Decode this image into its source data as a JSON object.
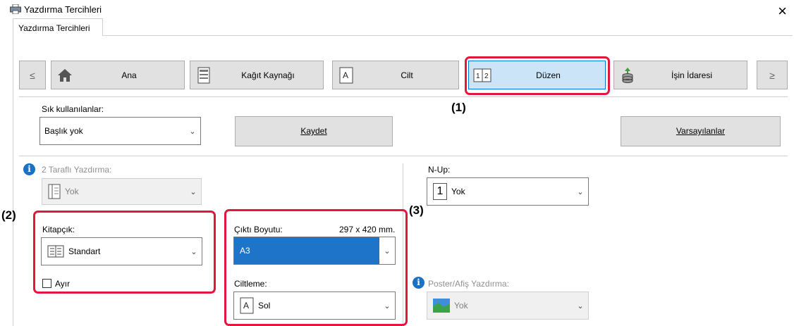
{
  "window": {
    "title": "Yazdırma Tercihleri",
    "close_glyph": "×"
  },
  "tab": {
    "label": "Yazdırma Tercihleri"
  },
  "nav": {
    "prev": "≤",
    "next": "≥",
    "buttons": [
      {
        "label": "Ana",
        "icon": "home-icon"
      },
      {
        "label": "Kağıt Kaynağı",
        "icon": "paper-tray-icon"
      },
      {
        "label": "Cilt",
        "icon": "binding-icon"
      },
      {
        "label": "Düzen",
        "icon": "layout-icon",
        "selected": true
      },
      {
        "label": "İşin İdaresi",
        "icon": "job-handling-icon"
      }
    ]
  },
  "favorites": {
    "label": "Sık kullanılanlar:",
    "value": "Başlık yok",
    "save": "Kaydet",
    "defaults": "Varsayılanlar"
  },
  "duplex": {
    "label": "2 Taraflı Yazdırma:",
    "value": "Yok"
  },
  "nup": {
    "label": "N-Up:",
    "value": "Yok",
    "number": "1"
  },
  "booklet": {
    "label": "Kitapçık:",
    "value": "Standart",
    "checkbox": "Ayır"
  },
  "output_size": {
    "label": "Çıktı Boyutu:",
    "dimension": "297 x 420 mm.",
    "value": "A3"
  },
  "binding": {
    "label": "Ciltleme:",
    "value": "Sol"
  },
  "poster": {
    "label": "Poster/Afiş Yazdırma:",
    "value": "Yok"
  },
  "callouts": {
    "c1": "(1)",
    "c2": "(2)",
    "c3": "(3)"
  },
  "colors": {
    "highlight": "#e3173e",
    "selected_bg": "#cce4f7",
    "select_blue": "#1e74c8"
  }
}
